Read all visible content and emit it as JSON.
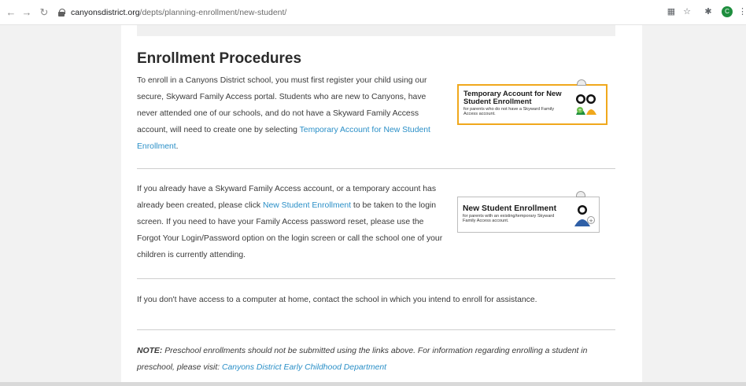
{
  "browser": {
    "url_host": "canyonsdistrict.org",
    "url_path": "/depts/planning-enrollment/new-student/",
    "profile_initial": "C"
  },
  "content": {
    "heading": "Enrollment Procedures",
    "p1_text": "To enroll in a Canyons District school, you must first register your child using our secure, Skyward Family Access portal. Students who are new to Canyons, have never attended one of our schools, and do not have a Skyward Family Access account, will need to create one by selecting ",
    "p1_link": "Temporary Account for New Student Enrollment",
    "p1_end": ".",
    "p2_text1": "If you already have a Skyward Family Access account, or a temporary account has already been created, please click ",
    "p2_link": "New Student Enrollment",
    "p2_text2": " to be taken to the login screen.  If you need to have your Family Access password reset, please use the Forgot Your Login/Password option on the login screen or call the school one of your children is currently attending.",
    "p3_text": "If you don't have access to a computer at home, contact the school in which you intend to enroll for assistance.",
    "note_label": "NOTE:",
    "note_text": " Preschool enrollments should not be submitted using the links above. For information regarding enrolling a student in preschool, please visit: ",
    "note_link": "Canyons District Early Childhood Department"
  },
  "buttons": {
    "temp_title": "Temporary Account for New Student Enrollment",
    "temp_sub": "for parents who do not have a Skyward Family Access account.",
    "new_title": "New Student Enrollment",
    "new_sub": "for parents with an existing/temporary Skyward Family Access account."
  },
  "colors": {
    "link": "#2a8fc7",
    "temp_border": "#f0a81c",
    "profile": "#1e8e3e"
  }
}
